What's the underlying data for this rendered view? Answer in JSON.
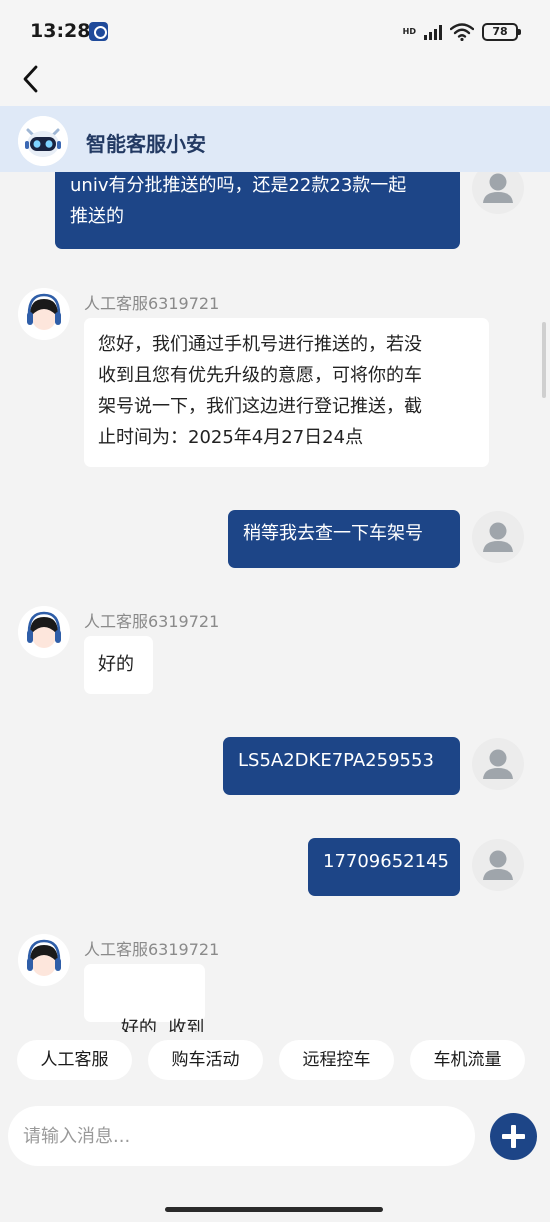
{
  "status_bar": {
    "time": "13:28",
    "hd_label": "HD",
    "battery": "78",
    "icons": [
      "app-icon",
      "signal-icon",
      "wifi-icon",
      "battery-icon"
    ]
  },
  "nav": {
    "back_icon": "chevron-left-icon"
  },
  "header": {
    "title": "智能客服小安",
    "avatar_icon": "robot-avatar"
  },
  "messages": [
    {
      "side": "out",
      "text_lines": [
        "univ有分批推送的吗，还是22款23款一起",
        "推送的"
      ]
    },
    {
      "side": "in",
      "sender": "人工客服6319721",
      "text_lines": [
        "您好，我们通过手机号进行推送的，若没",
        "收到且您有优先升级的意愿，可将你的车",
        "架号说一下，我们这边进行登记推送，截",
        "止时间为：2025年4月27日24点"
      ]
    },
    {
      "side": "out",
      "text": "稍等我去查一下车架号"
    },
    {
      "side": "in",
      "sender": "人工客服6319721",
      "text": "好的"
    },
    {
      "side": "out",
      "text": "LS5A2DKE7PA259553"
    },
    {
      "side": "out",
      "text": "17709652145"
    },
    {
      "side": "in",
      "sender": "人工客服6319721",
      "text": "好的  收到"
    }
  ],
  "quick_replies": [
    "人工客服",
    "购车活动",
    "远程控车",
    "车机流量"
  ],
  "composer": {
    "placeholder": "请输入消息...",
    "send_icon": "plus-icon"
  },
  "colors": {
    "accent": "#1d4587",
    "header_bg": "#dfe9f7",
    "chat_bg": "#f3f3f3"
  }
}
